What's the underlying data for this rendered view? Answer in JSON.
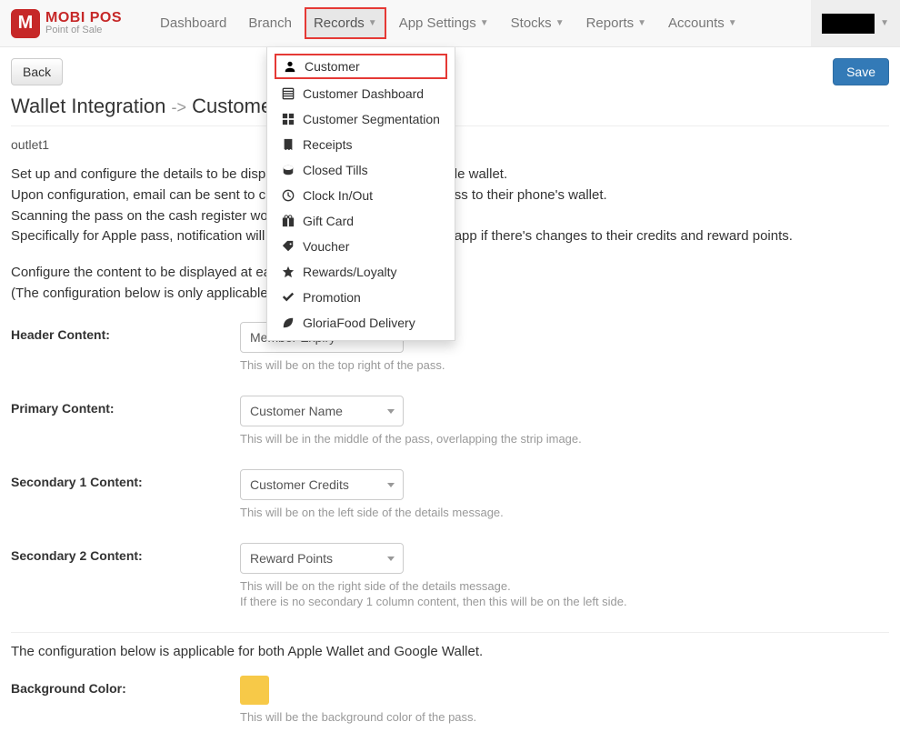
{
  "logo": {
    "title": "MOBI POS",
    "subtitle": "Point of Sale"
  },
  "nav": {
    "dashboard": "Dashboard",
    "branch": "Branch",
    "records": "Records",
    "app_settings": "App Settings",
    "stocks": "Stocks",
    "reports": "Reports",
    "accounts": "Accounts"
  },
  "dropdown": {
    "customer": "Customer",
    "customer_dashboard": "Customer Dashboard",
    "customer_segmentation": "Customer Segmentation",
    "receipts": "Receipts",
    "closed_tills": "Closed Tills",
    "clock": "Clock In/Out",
    "gift_card": "Gift Card",
    "voucher": "Voucher",
    "rewards": "Rewards/Loyalty",
    "promotion": "Promotion",
    "gloria": "GloriaFood Delivery"
  },
  "buttons": {
    "back": "Back",
    "save": "Save"
  },
  "page_title": {
    "main": "Wallet Integration",
    "arrow": "->",
    "sub": "Customer Pa"
  },
  "outlet": "outlet1",
  "desc": {
    "l1": "Set up and configure the details to be displa",
    "l1b": "gle wallet.",
    "l2": "Upon configuration, email can be sent to cus",
    "l2b": "ass to their phone's wallet.",
    "l3": "Scanning the pass on the cash register woul",
    "l4": "Specifically for Apple pass, notification will b",
    "l4b": "t app if there's changes to their credits and reward points.",
    "l5": "Configure the content to be displayed at eac",
    "l6": "(The configuration below is only applicable f"
  },
  "form": {
    "header": {
      "label": "Header Content:",
      "value": "Member Expiry",
      "help": "This will be on the top right of the pass."
    },
    "primary": {
      "label": "Primary Content:",
      "value": "Customer Name",
      "help": "This will be in the middle of the pass, overlapping the strip image."
    },
    "sec1": {
      "label": "Secondary 1 Content:",
      "value": "Customer Credits",
      "help": "This will be on the left side of the details message."
    },
    "sec2": {
      "label": "Secondary 2 Content:",
      "value": "Reward Points",
      "help1": "This will be on the right side of the details message.",
      "help2": "If there is no secondary 1 column content, then this will be on the left side."
    },
    "note": "The configuration below is applicable for both Apple Wallet and Google Wallet.",
    "bg": {
      "label": "Background Color:",
      "help": "This will be the background color of the pass."
    }
  }
}
